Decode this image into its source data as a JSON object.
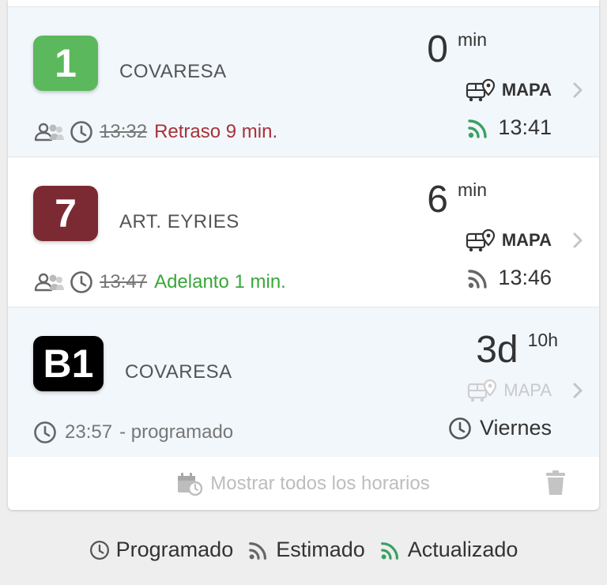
{
  "colors": {
    "line_1": "#5cb85c",
    "line_7": "#7b2a33",
    "line_b1": "#000000",
    "delay": "#a83238",
    "early": "#3aa63a",
    "updated_icon": "#3aa062",
    "estimated_icon": "#666666",
    "muted": "#bdbdbd"
  },
  "rows": [
    {
      "line": "1",
      "destination": "COVARESA",
      "eta_value": "0",
      "eta_unit": "min",
      "map_label": "MAPA",
      "time_icon": "wifi-updated-icon",
      "time": "13:41",
      "scheduled": "13:32",
      "status": "Retraso 9 min."
    },
    {
      "line": "7",
      "destination": "ART. EYRIES",
      "eta_value": "6",
      "eta_unit": "min",
      "map_label": "MAPA",
      "time_icon": "wifi-estimated-icon",
      "time": "13:46",
      "scheduled": "13:47",
      "status": "Adelanto 1 min."
    },
    {
      "line": "B1",
      "destination": "COVARESA",
      "eta_value": "3d",
      "eta_unit": "10h",
      "map_label": "MAPA",
      "map_disabled": true,
      "time_icon": "clock-icon",
      "time": "Viernes",
      "scheduled": "23:57",
      "status": "- programado"
    }
  ],
  "footer": {
    "label": "Mostrar todos los horarios",
    "icon": "calendar-clock-icon",
    "delete_icon": "trash-icon"
  },
  "legend": {
    "programado": "Programado",
    "estimado": "Estimado",
    "actualizado": "Actualizado"
  }
}
